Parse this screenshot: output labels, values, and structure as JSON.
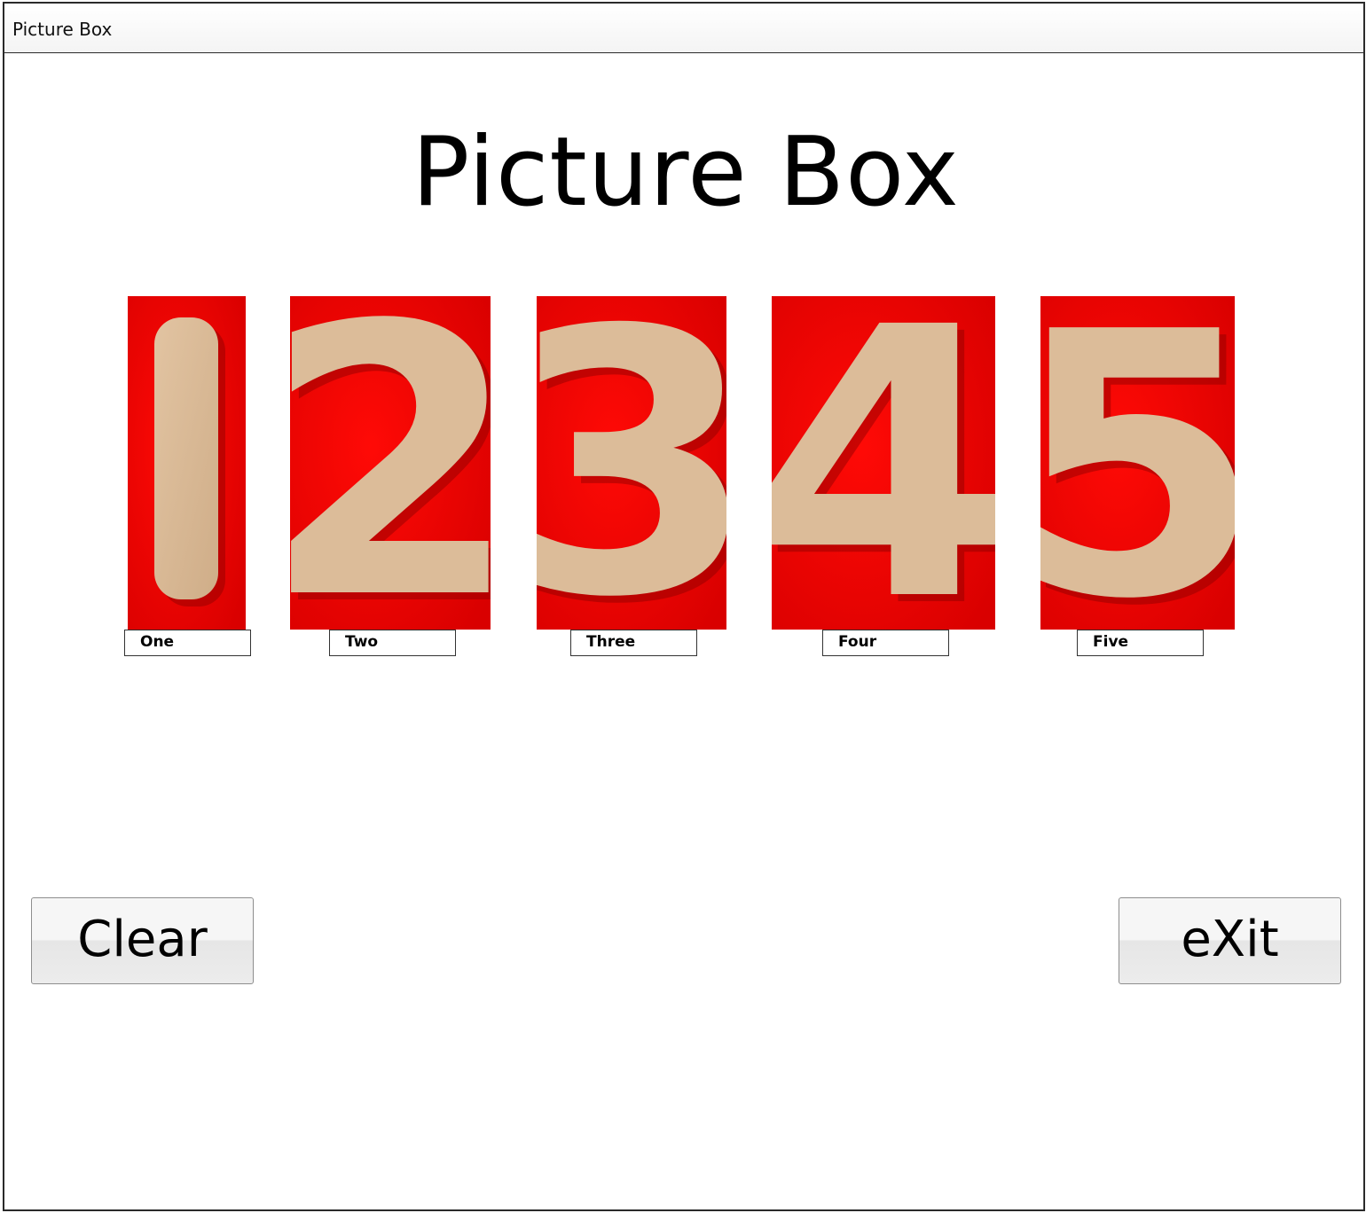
{
  "window": {
    "title": "Picture Box"
  },
  "main": {
    "heading": "Picture Box",
    "pictures": [
      {
        "digit": "1",
        "label": "One"
      },
      {
        "digit": "2",
        "label": "Two"
      },
      {
        "digit": "3",
        "label": "Three"
      },
      {
        "digit": "4",
        "label": "Four"
      },
      {
        "digit": "5",
        "label": "Five"
      }
    ]
  },
  "buttons": {
    "clear_label": "Clear",
    "exit_label": "eXit"
  },
  "colors": {
    "picture_background": "#ff0000",
    "digit_wood": "#d9b894"
  }
}
